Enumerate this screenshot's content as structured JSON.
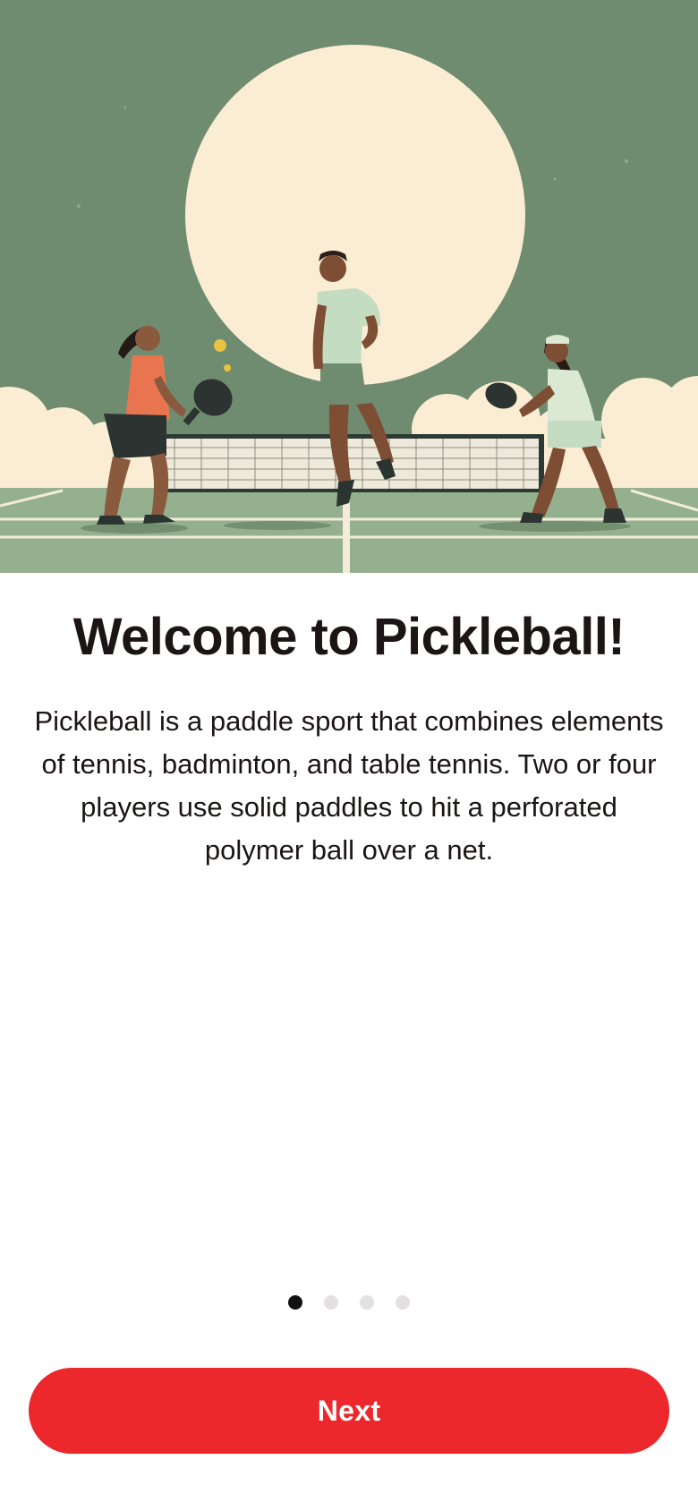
{
  "hero": {
    "image_label": "pickleball-players-illustration"
  },
  "onboarding": {
    "title": "Welcome to Pickleball!",
    "description": "Pickleball is a paddle sport that combines elements of tennis, badminton, and table tennis. Two or four players use solid paddles to hit a perforated polymer ball over a net.",
    "page_count": 4,
    "current_page": 1
  },
  "actions": {
    "next_label": "Next"
  },
  "colors": {
    "accent": "#ec282c",
    "sky": "#6f8c70",
    "sun": "#fbedd3",
    "court": "#94b08f",
    "text": "#1c1516"
  }
}
